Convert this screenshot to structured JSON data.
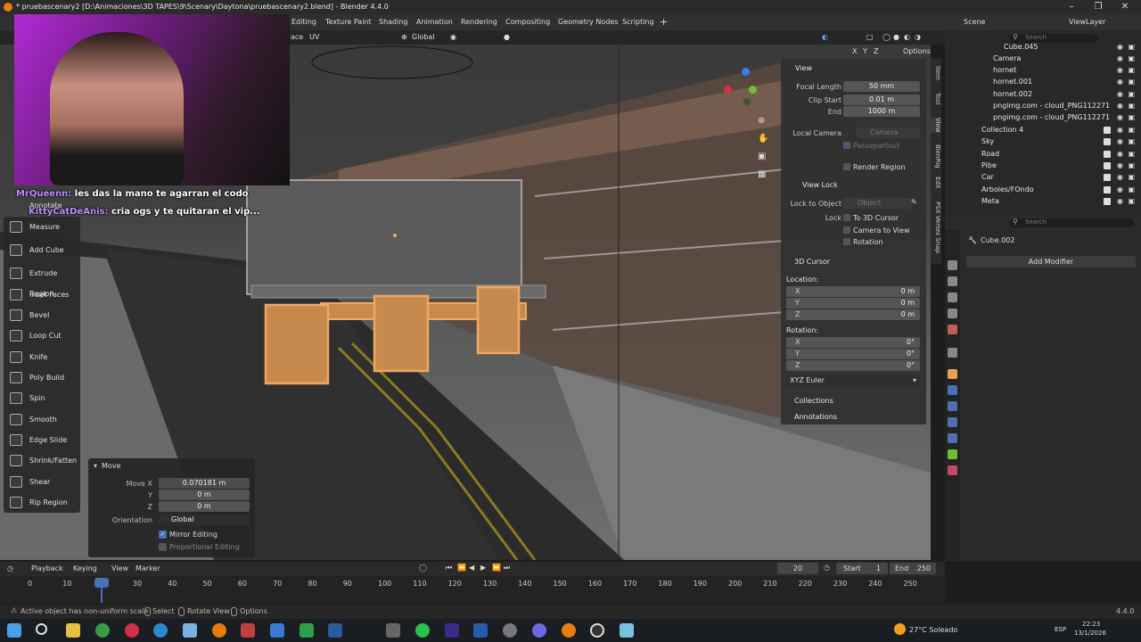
{
  "window": {
    "title": "* pruebascenary2 [D:\\Animaciones\\3D TAPES\\9\\Scenary\\Daytona\\pruebascenary2.blend] - Blender 4.4.0"
  },
  "menubar": {
    "items": [
      "Editing",
      "Texture Paint",
      "Shading",
      "Animation",
      "Rendering",
      "Compositing",
      "Geometry Nodes",
      "Scripting"
    ],
    "add_tab": "+",
    "scene_label": "Scene",
    "view_layer_label": "ViewLayer"
  },
  "header": {
    "face_label": "ace",
    "uv_label": "UV",
    "orientation": "Global",
    "options_label": "Options",
    "axes": [
      "X",
      "Y",
      "Z"
    ]
  },
  "chat": {
    "line1_user": "MrQueenn:",
    "line1_text": "les das la mano te agarran el codo",
    "line2_user": "KittyCatDeAnis:",
    "line2_text": "cria ogs y te quitaran el vip..."
  },
  "toolbar": {
    "annotate": "Annotate",
    "items": [
      "Measure",
      "Add Cube",
      "Extrude Region",
      "Inset Faces",
      "Bevel",
      "Loop Cut",
      "Knife",
      "Poly Build",
      "Spin",
      "Smooth",
      "Edge Slide",
      "Shrink/Fatten",
      "Shear",
      "Rip Region"
    ]
  },
  "operator_panel": {
    "title": "Move",
    "move_x_label": "Move X",
    "move_x": "0.070181 m",
    "y_label": "Y",
    "y": "0 m",
    "z_label": "Z",
    "z": "0 m",
    "orientation_label": "Orientation",
    "orientation": "Global",
    "mirror_editing": "Mirror Editing",
    "proportional_editing": "Proportional Editing"
  },
  "npanel": {
    "view_title": "View",
    "focal_length_label": "Focal Length",
    "focal_length": "50 mm",
    "clip_start_label": "Clip Start",
    "clip_start": "0.01 m",
    "end_label": "End",
    "end": "1000 m",
    "local_camera_label": "Local Camera",
    "local_camera": "Camera",
    "passepartout": "Passepartout",
    "render_region": "Render Region",
    "view_lock_title": "View Lock",
    "lock_to_object_label": "Lock to Object",
    "lock_to_object": "Object",
    "lock_label": "Lock",
    "to_3d_cursor": "To 3D Cursor",
    "camera_to_view": "Camera to View",
    "rotation_lock": "Rotation",
    "cursor_title": "3D Cursor",
    "location_label": "Location:",
    "loc_x": "0 m",
    "loc_y": "0 m",
    "loc_z": "0 m",
    "rotation_label": "Rotation:",
    "rot_x": "0°",
    "rot_y": "0°",
    "rot_z": "0°",
    "rotation_mode": "XYZ Euler",
    "collections": "Collections",
    "annotations": "Annotations",
    "vec_x": "X",
    "vec_y": "Y",
    "vec_z": "Z"
  },
  "sidetabs": [
    "Item",
    "Tool",
    "View",
    "BlenRig",
    "Edit",
    "PSX Vertex Snap"
  ],
  "outliner": {
    "search_placeholder": "Search",
    "rows": [
      {
        "name": "Cube.045"
      },
      {
        "name": "Camera"
      },
      {
        "name": "hornet"
      },
      {
        "name": "hornet.001"
      },
      {
        "name": "hornet.002"
      },
      {
        "name": "pngimg.com - cloud_PNG112271"
      },
      {
        "name": "pngimg.com - cloud_PNG112271"
      },
      {
        "name": "Collection 4"
      },
      {
        "name": "Sky"
      },
      {
        "name": "Road"
      },
      {
        "name": "Pibe"
      },
      {
        "name": "Car"
      },
      {
        "name": "Arboles/FOndo"
      },
      {
        "name": "Meta"
      }
    ]
  },
  "properties": {
    "search_placeholder": "Search",
    "object_name": "Cube.002",
    "add_modifier": "Add Modifier"
  },
  "timeline": {
    "menus": [
      "Playback",
      "Keying",
      "View",
      "Marker"
    ],
    "current_frame": "20",
    "start_label": "Start",
    "start": "1",
    "end_label": "End",
    "end": "250",
    "ticks": [
      "0",
      "10",
      "20",
      "30",
      "40",
      "50",
      "60",
      "70",
      "80",
      "90",
      "100",
      "110",
      "120",
      "130",
      "140",
      "150",
      "160",
      "170",
      "180",
      "190",
      "200",
      "210",
      "220",
      "230",
      "240",
      "250"
    ]
  },
  "statusbar": {
    "warning": "Active object has non-uniform scale",
    "select": "Select",
    "rotate_view": "Rotate View",
    "options": "Options",
    "version": "4.4.0"
  },
  "taskbar": {
    "weather": "27°C  Soleado",
    "lang": "ESP",
    "time": "22:23",
    "date": "13/1/2026"
  },
  "colors": {
    "accent": "#4772b3",
    "selection": "#e8a050",
    "chat_user": "#c08cff"
  }
}
